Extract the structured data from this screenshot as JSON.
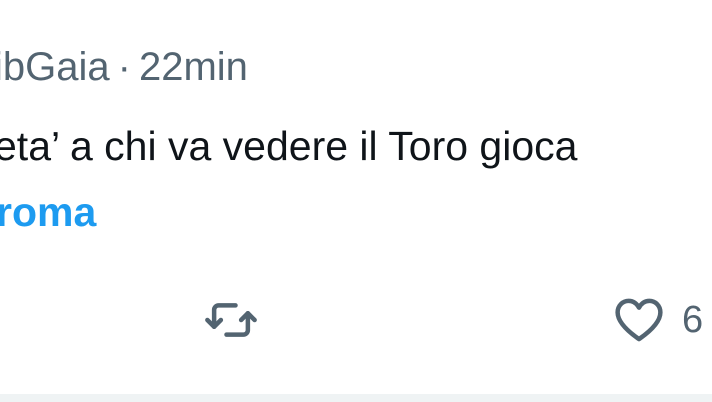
{
  "tweet": {
    "author_handle_partial": "ibGaia",
    "separator": "·",
    "timestamp": "22min",
    "text_line": "eta’  a chi va vedere il Toro gioca",
    "hashtag": "roma",
    "actions": {
      "retweet": {
        "icon": "retweet-icon"
      },
      "like": {
        "icon": "heart-icon",
        "count": "6"
      }
    }
  },
  "colors": {
    "text": "#0f1419",
    "secondary": "#536471",
    "link": "#1d9bf0",
    "divider": "#eff3f4"
  }
}
